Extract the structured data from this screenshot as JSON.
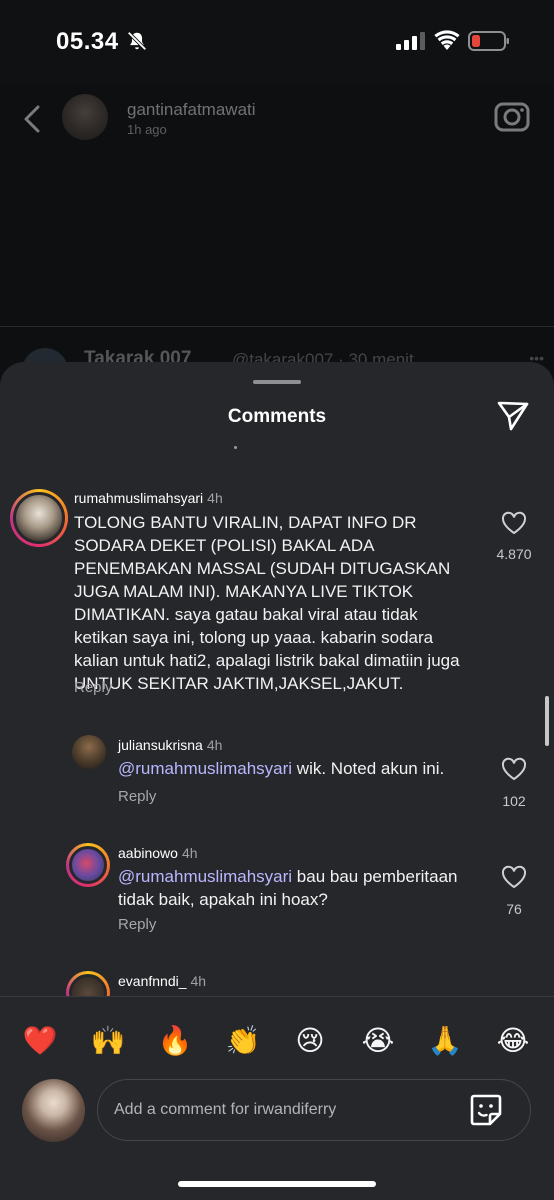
{
  "status_bar": {
    "time": "05.34",
    "icons": [
      "bell-slash-icon",
      "signal-icon",
      "wifi-icon",
      "battery-low-icon"
    ],
    "battery_color": "#e5453a"
  },
  "story": {
    "username": "gantinafatmawati",
    "time_ago": "1h ago",
    "peek_name": "Takarak 007",
    "peek_handle": "@takarak007 · 30 menit"
  },
  "sheet": {
    "title": "Comments"
  },
  "comments": [
    {
      "username": "rumahmuslimahsyari",
      "time": "4h",
      "text": "TOLONG BANTU VIRALIN, DAPAT INFO DR SODARA DEKET (POLISI) BAKAL ADA PENEMBAKAN MASSAL (SUDAH DITUGASKAN JUGA MALAM INI). MAKANYA LIVE TIKTOK DIMATIKAN. saya gatau bakal viral atau tidak ketikan saya ini, tolong up yaaa. kabarin sodara kalian untuk hati2, apalagi listrik bakal dimatiin juga UNTUK SEKITAR JAKTIM,JAKSEL,JAKUT.",
      "reply_label": "Reply",
      "likes": "4.870"
    },
    {
      "username": "juliansukrisna",
      "time": "4h",
      "mention": "@rumahmuslimahsyari",
      "text": " wik. Noted akun ini.",
      "reply_label": "Reply",
      "likes": "102"
    },
    {
      "username": "aabinowo",
      "time": "4h",
      "mention": "@rumahmuslimahsyari",
      "text": " bau bau pemberitaan tidak baik, apakah ini hoax?",
      "reply_label": "Reply",
      "likes": "76"
    },
    {
      "username": "evanfnndi_",
      "time": "4h"
    }
  ],
  "reactions": [
    "❤️",
    "🙌",
    "🔥",
    "👏",
    "😢",
    "😭",
    "🙏",
    "😂"
  ],
  "composer": {
    "placeholder": "Add a comment for irwandiferry"
  },
  "colors": {
    "sheet_bg": "#26272b",
    "mention": "#b9b7ff",
    "app_bg": "#0b0c0e"
  }
}
